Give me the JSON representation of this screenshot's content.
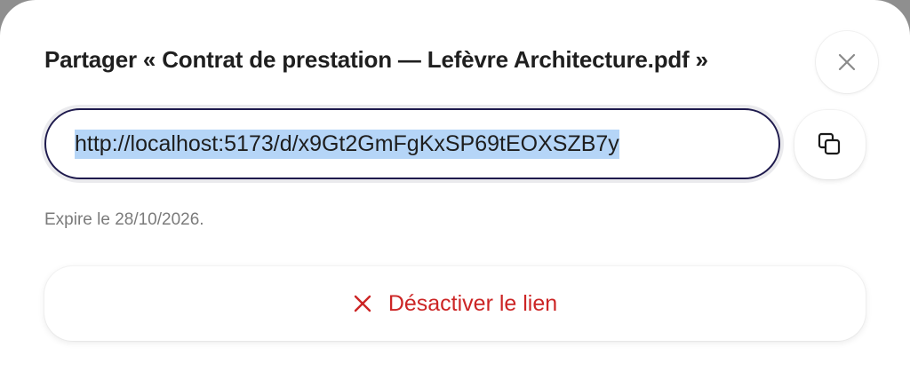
{
  "dialog": {
    "title": "Partager « Contrat de prestation — Lefèvre Architecture.pdf »",
    "close_icon": "close-icon",
    "share_link": {
      "value": "http://localhost:5173/d/x9Gt2GmFgKxSP69tEOXSZB7y",
      "selected": true
    },
    "copy_icon": "copy-icon",
    "expiry_text": "Expire le 28/10/2026.",
    "deactivate": {
      "icon": "x-icon",
      "label": "Désactiver le lien"
    }
  },
  "colors": {
    "accent_danger": "#cc2525",
    "focus_border": "#1e1a4d",
    "selection": "#b5d5f7"
  }
}
